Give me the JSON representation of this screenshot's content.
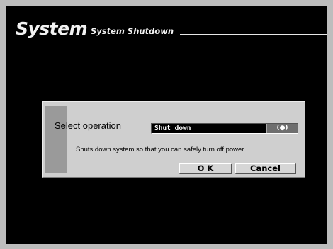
{
  "header": {
    "title": "System",
    "subtitle": "System Shutdown"
  },
  "dialog": {
    "operation_label": "Select operation",
    "select": {
      "value": "Shut down",
      "button_glyph": "(●)"
    },
    "message": "Shuts down system so that you can safely turn off power.",
    "ok_label": "O K",
    "cancel_label": "Cancel"
  },
  "colors": {
    "screen_bg": "#000000",
    "frame_bg": "#bdbdbd",
    "dialog_bg": "#cfcfcf"
  }
}
